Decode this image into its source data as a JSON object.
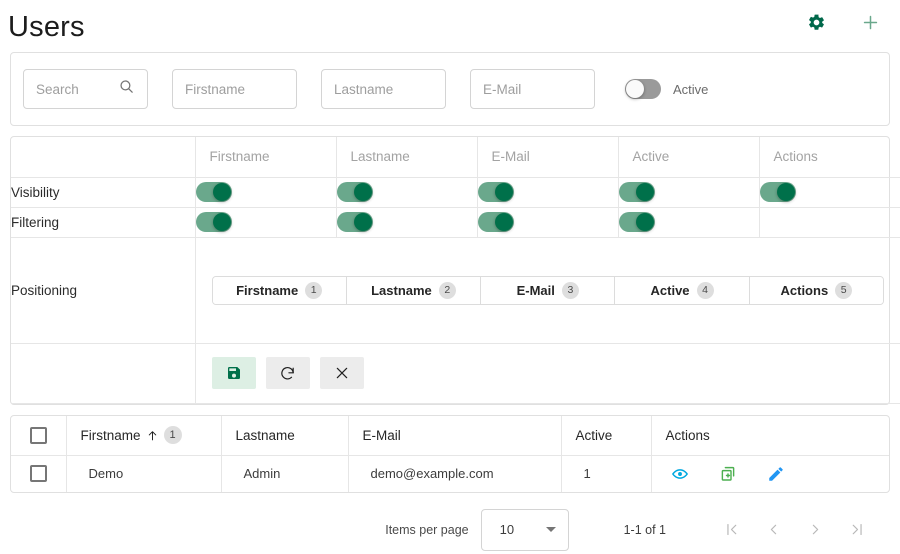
{
  "header": {
    "title": "Users",
    "settings_icon": "gear-icon",
    "add_icon": "plus-icon"
  },
  "filter_bar": {
    "search": {
      "value": "",
      "placeholder": "Search",
      "icon": "search-icon"
    },
    "firstname": {
      "value": "",
      "placeholder": "Firstname"
    },
    "lastname": {
      "value": "",
      "placeholder": "Lastname"
    },
    "email": {
      "value": "",
      "placeholder": "E-Mail"
    },
    "active_toggle": {
      "label": "Active",
      "state": "off"
    }
  },
  "settings_panel": {
    "columns": [
      "Firstname",
      "Lastname",
      "E-Mail",
      "Active",
      "Actions"
    ],
    "rows": [
      {
        "label": "Visibility",
        "toggles": [
          true,
          true,
          true,
          true,
          true
        ]
      },
      {
        "label": "Filtering",
        "toggles": [
          true,
          true,
          true,
          true,
          null
        ]
      }
    ],
    "positioning": {
      "label": "Positioning",
      "chips": [
        {
          "label": "Firstname",
          "order": "1"
        },
        {
          "label": "Lastname",
          "order": "2"
        },
        {
          "label": "E-Mail",
          "order": "3"
        },
        {
          "label": "Active",
          "order": "4"
        },
        {
          "label": "Actions",
          "order": "5"
        }
      ]
    },
    "buttons": [
      {
        "name": "save-button",
        "icon": "save-floppy-icon"
      },
      {
        "name": "reset-button",
        "icon": "refresh-icon"
      },
      {
        "name": "close-button",
        "icon": "close-x-icon"
      }
    ]
  },
  "data_table": {
    "headers": {
      "select_all": "",
      "firstname": "Firstname",
      "firstname_sort": "ascending",
      "firstname_sort_order": "1",
      "lastname": "Lastname",
      "email": "E-Mail",
      "active": "Active",
      "actions": "Actions"
    },
    "rows": [
      {
        "selected": false,
        "firstname": "Demo",
        "lastname": "Admin",
        "email": "demo@example.com",
        "active": "1",
        "actions": [
          "view-icon",
          "duplicate-icon",
          "edit-icon"
        ]
      }
    ]
  },
  "paginator": {
    "items_per_page_label": "Items per page",
    "items_per_page_value": "10",
    "range_label": "1-1 of 1",
    "buttons": [
      {
        "name": "first-page-button",
        "icon": "first-page-icon"
      },
      {
        "name": "previous-page-button",
        "icon": "chevron-left-icon"
      },
      {
        "name": "next-page-button",
        "icon": "chevron-right-icon"
      },
      {
        "name": "last-page-button",
        "icon": "last-page-icon"
      }
    ]
  },
  "colors": {
    "accent_dark_green": "#00684a",
    "accent_light_green": "#6aa88c",
    "toggle_thumb": "#00704a",
    "view_icon": "#00a9e0",
    "duplicate_icon": "#4caf50",
    "edit_icon": "#2196f3",
    "border": "#e0e0e0"
  }
}
